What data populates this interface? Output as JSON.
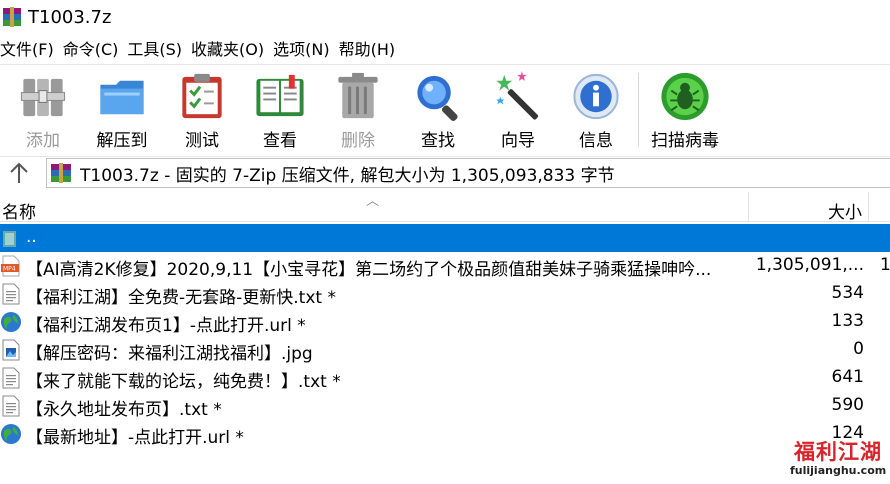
{
  "window": {
    "title": "T1003.7z"
  },
  "menu": [
    "文件(F)",
    "命令(C)",
    "工具(S)",
    "收藏夹(O)",
    "选项(N)",
    "帮助(H)"
  ],
  "toolbar": {
    "add": "添加",
    "extract": "解压到",
    "test": "测试",
    "view": "查看",
    "delete": "删除",
    "find": "查找",
    "wizard": "向导",
    "info": "信息",
    "scan": "扫描病毒"
  },
  "address": {
    "path": "T1003.7z - 固实的 7-Zip 压缩文件, 解包大小为 1,305,093,833 字节"
  },
  "columns": {
    "name": "名称",
    "size": "大小"
  },
  "files": [
    {
      "name": "..",
      "size": "",
      "icon": "folder-up-icon"
    },
    {
      "name": "【AI高清2K修复】2020,9,11【小宝寻花】第二场约了个极品颜值甜美妹子骑乘猛操呻吟...",
      "size": "1,305,091,...",
      "extra": "1",
      "icon": "mp4-file-icon"
    },
    {
      "name": "【福利江湖】全免费-无套路-更新快.txt *",
      "size": "534",
      "icon": "text-file-icon"
    },
    {
      "name": "【福利江湖发布页1】-点此打开.url *",
      "size": "133",
      "icon": "url-file-icon"
    },
    {
      "name": "【解压密码：来福利江湖找福利】.jpg",
      "size": "0",
      "icon": "image-file-icon"
    },
    {
      "name": "【来了就能下载的论坛，纯免费！】.txt *",
      "size": "641",
      "icon": "text-file-icon"
    },
    {
      "name": "【永久地址发布页】.txt *",
      "size": "590",
      "icon": "text-file-icon"
    },
    {
      "name": "【最新地址】-点此打开.url *",
      "size": "124",
      "icon": "url-file-icon"
    }
  ],
  "watermark": {
    "cn": "福利江湖",
    "en": "fulijianghu.com"
  },
  "colors": {
    "selection": "#0078d7",
    "disabled_text": "#9a9a9a"
  }
}
